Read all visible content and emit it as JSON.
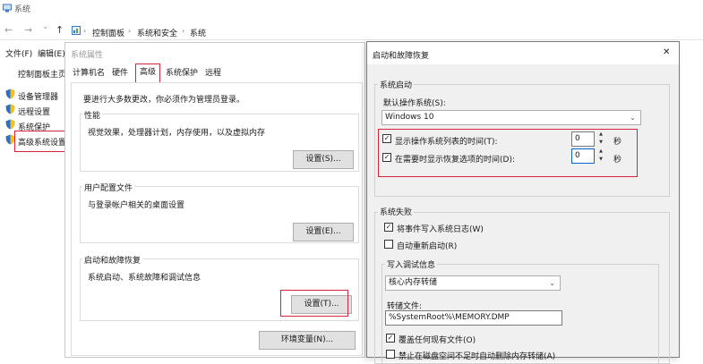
{
  "explorer": {
    "window_title": "系统",
    "back_icon": "←",
    "forward_icon": "→",
    "dropdown_icon": "⌄",
    "up_icon": "↑",
    "breadcrumb": [
      "控制面板",
      "系统和安全",
      "系统"
    ],
    "menu": [
      "文件(F)",
      "编辑(E)"
    ],
    "sidebar_home": "控制面板主页",
    "sidebar_items": [
      "设备管理器",
      "远程设置",
      "系统保护",
      "高级系统设置"
    ]
  },
  "sysprops": {
    "title": "系统属性",
    "tabs": [
      "计算机名",
      "硬件",
      "高级",
      "系统保护",
      "远程"
    ],
    "admin_note": "要进行大多数更改，你必须作为管理员登录。",
    "performance": {
      "legend": "性能",
      "desc": "视觉效果，处理器计划，内存使用，以及虚拟内存",
      "button": "设置(S)..."
    },
    "profiles": {
      "legend": "用户配置文件",
      "desc": "与登录帐户相关的桌面设置",
      "button": "设置(E)..."
    },
    "startup": {
      "legend": "启动和故障恢复",
      "desc": "系统启动、系统故障和调试信息",
      "button": "设置(T)..."
    },
    "env_button": "环境变量(N)..."
  },
  "recovery": {
    "title": "启动和故障恢复",
    "close_icon": "✕",
    "system_startup": {
      "legend": "系统启动",
      "default_os_label": "默认操作系统(S):",
      "default_os_value": "Windows 10",
      "show_os_list": {
        "label": "显示操作系统列表的时间(T):",
        "checked": true,
        "value": "0",
        "unit": "秒"
      },
      "show_recovery": {
        "label": "在需要时显示恢复选项的时间(D):",
        "checked": true,
        "value": "0",
        "unit": "秒"
      }
    },
    "system_failure": {
      "legend": "系统失败",
      "write_event": {
        "label": "将事件写入系统日志(W)",
        "checked": true
      },
      "auto_restart": {
        "label": "自动重新启动(R)",
        "checked": false
      },
      "debug": {
        "legend": "写入调试信息",
        "type_value": "核心内存转储",
        "dump_file_label": "转储文件:",
        "dump_file_value": "%SystemRoot%\\MEMORY.DMP",
        "overwrite": {
          "label": "覆盖任何现有文件(O)",
          "checked": true
        },
        "disable_auto_delete": {
          "label": "禁止在磁盘空间不足时自动删除内存转储(A)",
          "checked": false
        }
      }
    }
  },
  "colors": {
    "highlight_red": "#d4233a",
    "dialog_bg": "#f0f0f0",
    "shield_blue": "#2a6fc9",
    "shield_yellow": "#f2c21b"
  }
}
